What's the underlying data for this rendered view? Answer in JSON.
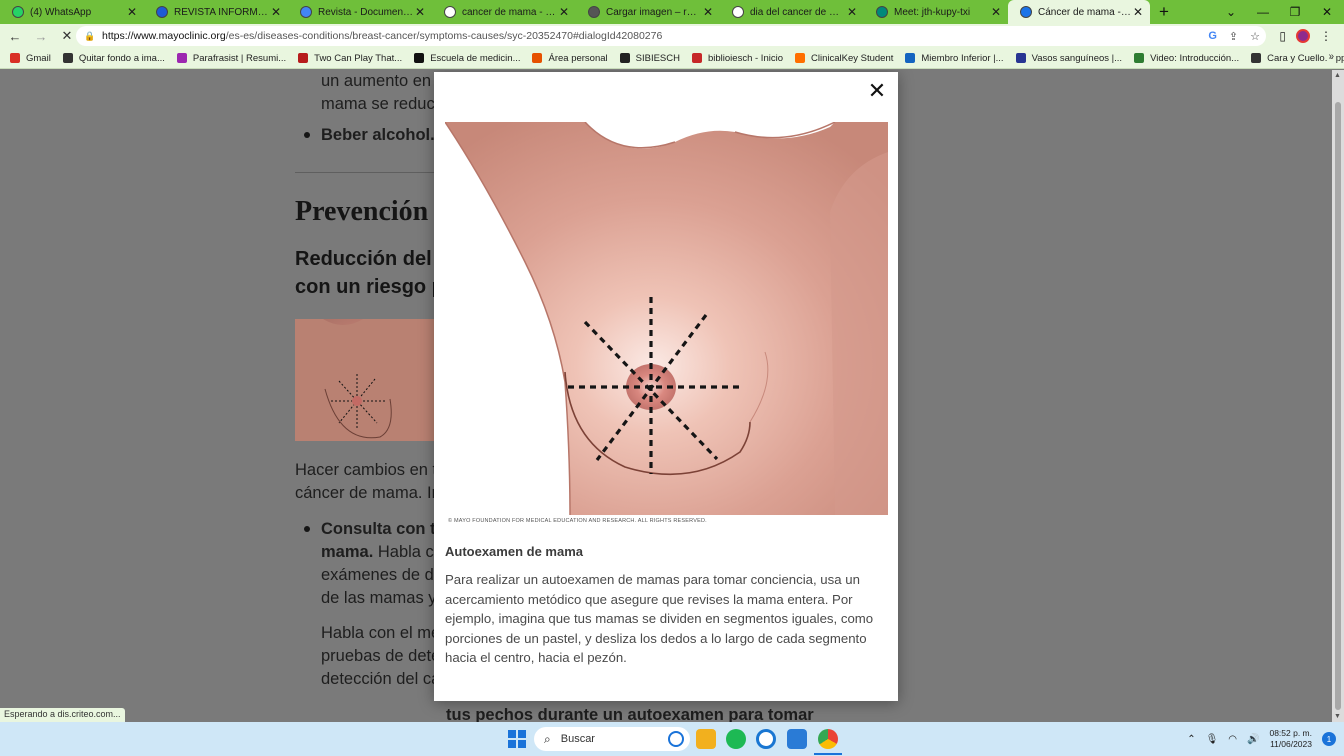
{
  "browser": {
    "tabs": [
      {
        "title": "(4) WhatsApp",
        "color": "#25d366"
      },
      {
        "title": "REVISTA INFORMATICA - C",
        "color": "#1e5bd6"
      },
      {
        "title": "Revista - Documentos de G",
        "color": "#4285f4"
      },
      {
        "title": "cancer de mama - Búsque",
        "color": "#ffffff"
      },
      {
        "title": "Cargar imagen – remove.b",
        "color": "#555555"
      },
      {
        "title": "dia del cancer de mama - C",
        "color": "#ffffff"
      },
      {
        "title": "Meet: jth-kupy-txi",
        "color": "#00897b"
      },
      {
        "title": "Cáncer de mama - Síntom",
        "color": "#1a73e8",
        "active": true
      }
    ],
    "url_host": "https://www.mayoclinic.org",
    "url_path": "/es-es/diseases-conditions/breast-cancer/symptoms-causes/syc-20352470#dialogId42080276",
    "bookmarks": [
      {
        "label": "Gmail",
        "color": "#d93025"
      },
      {
        "label": "Quitar fondo a ima...",
        "color": "#333333"
      },
      {
        "label": "Parafrasist | Resumi...",
        "color": "#9c27b0"
      },
      {
        "label": "Two Can Play That...",
        "color": "#b71c1c"
      },
      {
        "label": "Escuela de medicin...",
        "color": "#111111"
      },
      {
        "label": "Área personal",
        "color": "#e65100"
      },
      {
        "label": "SIBIESCH",
        "color": "#222222"
      },
      {
        "label": "biblioiesch - Inicio",
        "color": "#c62828"
      },
      {
        "label": "ClinicalKey Student",
        "color": "#ff6f00"
      },
      {
        "label": "Miembro Inferior |...",
        "color": "#1565c0"
      },
      {
        "label": "Vasos sanguíneos |...",
        "color": "#283593"
      },
      {
        "label": "Video: Introducción...",
        "color": "#2e7d32"
      },
      {
        "label": "Cara y Cuello. - ppt...",
        "color": "#333333"
      }
    ],
    "status_text": "Esperando a dis.criteo.com..."
  },
  "background_page": {
    "line1": "un aumento en s",
    "line2": "mama se reduce",
    "bullet1_bold": "Beber alcohol.",
    "bullet1_rest": " B",
    "heading_prevention": "Prevención",
    "subheading_line1": "Reducción del",
    "subheading_line2": "con un riesgo p",
    "para_line1": "Hacer cambios en tu",
    "para_line2": "cáncer de mama. Int",
    "bullet2_bold_1": "Consulta con tu",
    "bullet2_bold_2": "mama.",
    "bullet2_rest": " Habla co",
    "bullet2_line3": "exámenes de de",
    "bullet2_line4": "de las mamas y r",
    "para2_line1": "Habla con el méd",
    "para2_line2": "pruebas de dete",
    "para2_line3": "detección del cá",
    "bottom_bold": "tus pechos durante un autoexamen para tomar"
  },
  "modal": {
    "copyright": "© MAYO FOUNDATION FOR MEDICAL EDUCATION AND RESEARCH. ALL RIGHTS RESERVED.",
    "caption_title": "Autoexamen de mama",
    "caption_body": "Para realizar un autoexamen de mamas para tomar conciencia, usa un acercamiento metódico que asegure que revises la mama entera. Por ejemplo, imagina que tus mamas se dividen en segmentos iguales, como porciones de un pastel, y desliza los dedos a lo largo de cada segmento hacia el centro, hacia el pezón."
  },
  "taskbar": {
    "search_placeholder": "Buscar",
    "time": "08:52 p. m.",
    "date": "11/06/2023",
    "notifications": "1"
  }
}
